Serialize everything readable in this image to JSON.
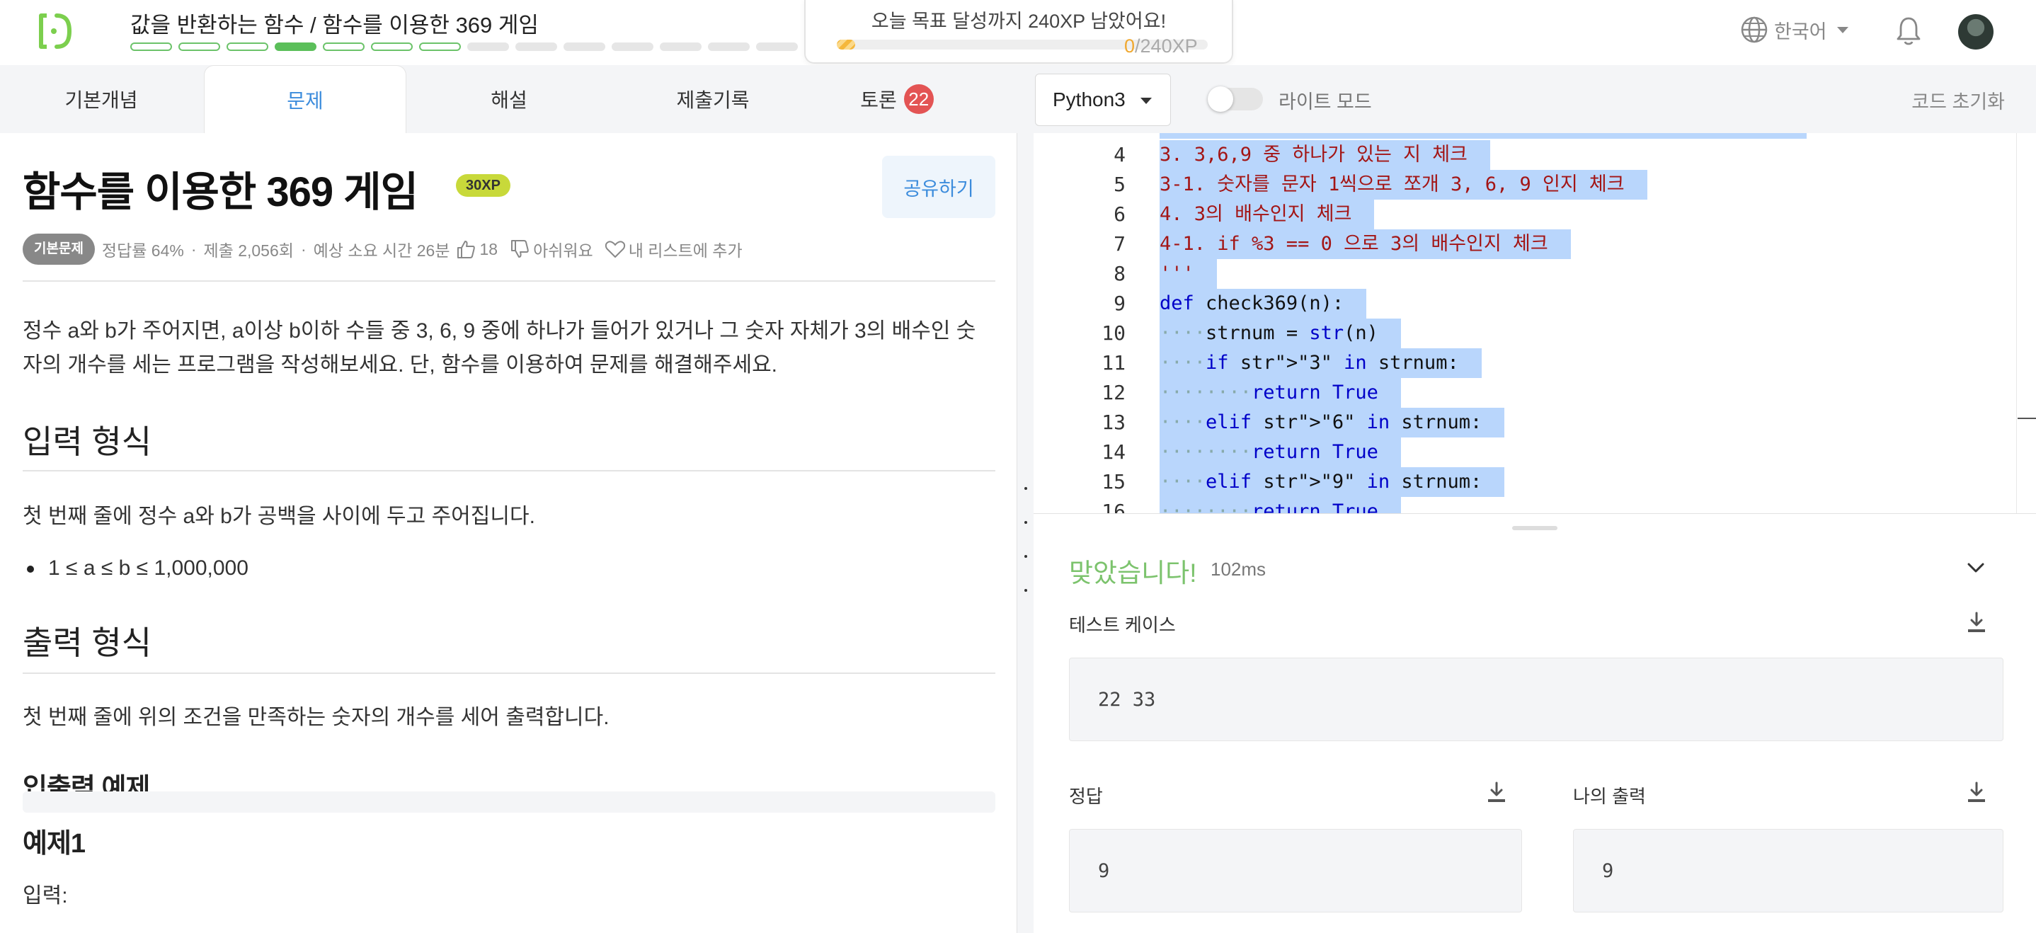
{
  "header": {
    "course_title": "값을 반환하는 함수 / 함수를 이용한 369 게임",
    "progress": {
      "completed_segments": 3,
      "current_segment": 4,
      "total_segments": 17,
      "visited_segments": 7
    },
    "goal": {
      "message": "오늘 목표 달성까지 240XP 남았어요!",
      "current": "0",
      "target": "/240XP",
      "fill_fraction": 0.05
    },
    "language": "한국어",
    "icons": {
      "logo": "codeit-logo-icon",
      "globe": "globe-icon",
      "bell": "bell-icon",
      "avatar": "avatar"
    }
  },
  "tabs": [
    {
      "label": "기본개념"
    },
    {
      "label": "문제",
      "active": true
    },
    {
      "label": "해설"
    },
    {
      "label": "제출기록"
    },
    {
      "label": "토론",
      "badge": "22"
    }
  ],
  "toolbar": {
    "language_select": "Python3",
    "theme_toggle_label": "라이트 모드",
    "reset_code": "코드 초기화"
  },
  "problem": {
    "title": "함수를 이용한 369 게임",
    "xp": "30XP",
    "share": "공유하기",
    "meta": {
      "badge": "기본문제",
      "accuracy": "정답률 64%",
      "submissions": "제출 2,056회",
      "est_time": "예상 소요 시간 26분",
      "likes": "18",
      "dislike": "아쉬워요",
      "add_list": "내 리스트에 추가"
    },
    "description_line1": "정수 a와 b가 주어지면, a이상 b이하 수들 중 3, 6, 9 중에 하나가 들어가 있거나 그 숫자 자체가 3의 배수인 숫",
    "description_line2": "자의 개수를 세는 프로그램을 작성해보세요. 단, 함수를 이용하여 문제를 해결해주세요.",
    "input_heading": "입력 형식",
    "input_text": "첫 번째 줄에 정수 a와 b가 공백을 사이에 두고 주어집니다.",
    "input_constraint": "1 ≤ a ≤ b ≤ 1,000,000",
    "output_heading": "출력 형식",
    "output_text": "첫 번째 줄에 위의 조건을 만족하는 숫자의 개수를 세어 출력합니다.",
    "examples_heading": "입출력 예제",
    "example1_heading": "예제1",
    "input_label": "입력:"
  },
  "code": {
    "lines": [
      {
        "n": "4",
        "text": "3. 3,6,9 중 하나가 있는 지 체크"
      },
      {
        "n": "5",
        "text": "3-1. 숫자를 문자 1씩으로 쪼개 3, 6, 9 인지 체크"
      },
      {
        "n": "6",
        "text": "4. 3의 배수인지 체크"
      },
      {
        "n": "7",
        "text": "4-1. if %3 == 0 으로 3의 배수인지 체크"
      },
      {
        "n": "8",
        "text": "'''"
      },
      {
        "n": "9",
        "text": "def check369(n):"
      },
      {
        "n": "10",
        "text": "    strnum = str(n)"
      },
      {
        "n": "11",
        "text": "    if \"3\" in strnum:"
      },
      {
        "n": "12",
        "text": "        return True"
      },
      {
        "n": "13",
        "text": "    elif \"6\" in strnum:"
      },
      {
        "n": "14",
        "text": "        return True"
      },
      {
        "n": "15",
        "text": "    elif \"9\" in strnum:"
      },
      {
        "n": "16",
        "text": "        return True"
      }
    ]
  },
  "result": {
    "status": "맞았습니다!",
    "time": "102ms",
    "test_case_label": "테스트 케이스",
    "test_case_value": "22 33",
    "answer_label": "정답",
    "answer_value": "9",
    "my_output_label": "나의 출력",
    "my_output_value": "9"
  },
  "colors": {
    "accent_blue": "#3c8cdc",
    "success_green": "#7cc36d",
    "progress_green": "#5bbf5a",
    "badge_red": "#e35454",
    "selection": "#b9d6fc"
  }
}
